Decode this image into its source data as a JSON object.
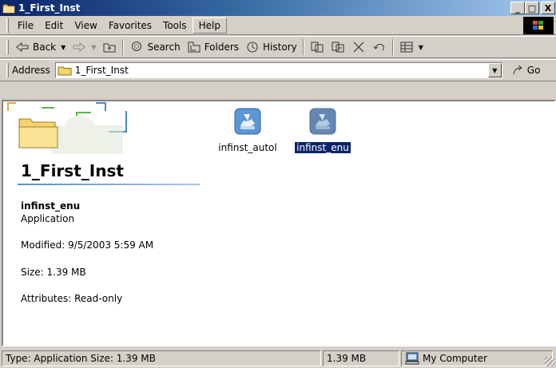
{
  "window": {
    "title": "1_First_Inst",
    "min": "_",
    "max": "□",
    "close": "X"
  },
  "menu": [
    "File",
    "Edit",
    "View",
    "Favorites",
    "Tools",
    "Help"
  ],
  "toolbar": {
    "back": "Back",
    "search": "Search",
    "folders": "Folders",
    "history": "History"
  },
  "address": {
    "label": "Address",
    "value": "1_First_Inst",
    "go": "Go"
  },
  "webview": {
    "title": "1_First_Inst",
    "name": "infinst_enu",
    "type": "Application",
    "modified": "Modified: 9/5/2003 5:59 AM",
    "size": "Size: 1.39 MB",
    "attributes": "Attributes: Read-only"
  },
  "files": [
    {
      "name": "infinst_autol",
      "selected": false
    },
    {
      "name": "infinst_enu",
      "selected": true
    }
  ],
  "status": {
    "info": "Type: Application Size: 1.39 MB",
    "size": "1.39 MB",
    "zone": "My Computer"
  },
  "colors": {
    "title_start": "#0a246a",
    "title_end": "#a6caf0",
    "selection": "#0a246a",
    "face": "#d4d0c8"
  }
}
